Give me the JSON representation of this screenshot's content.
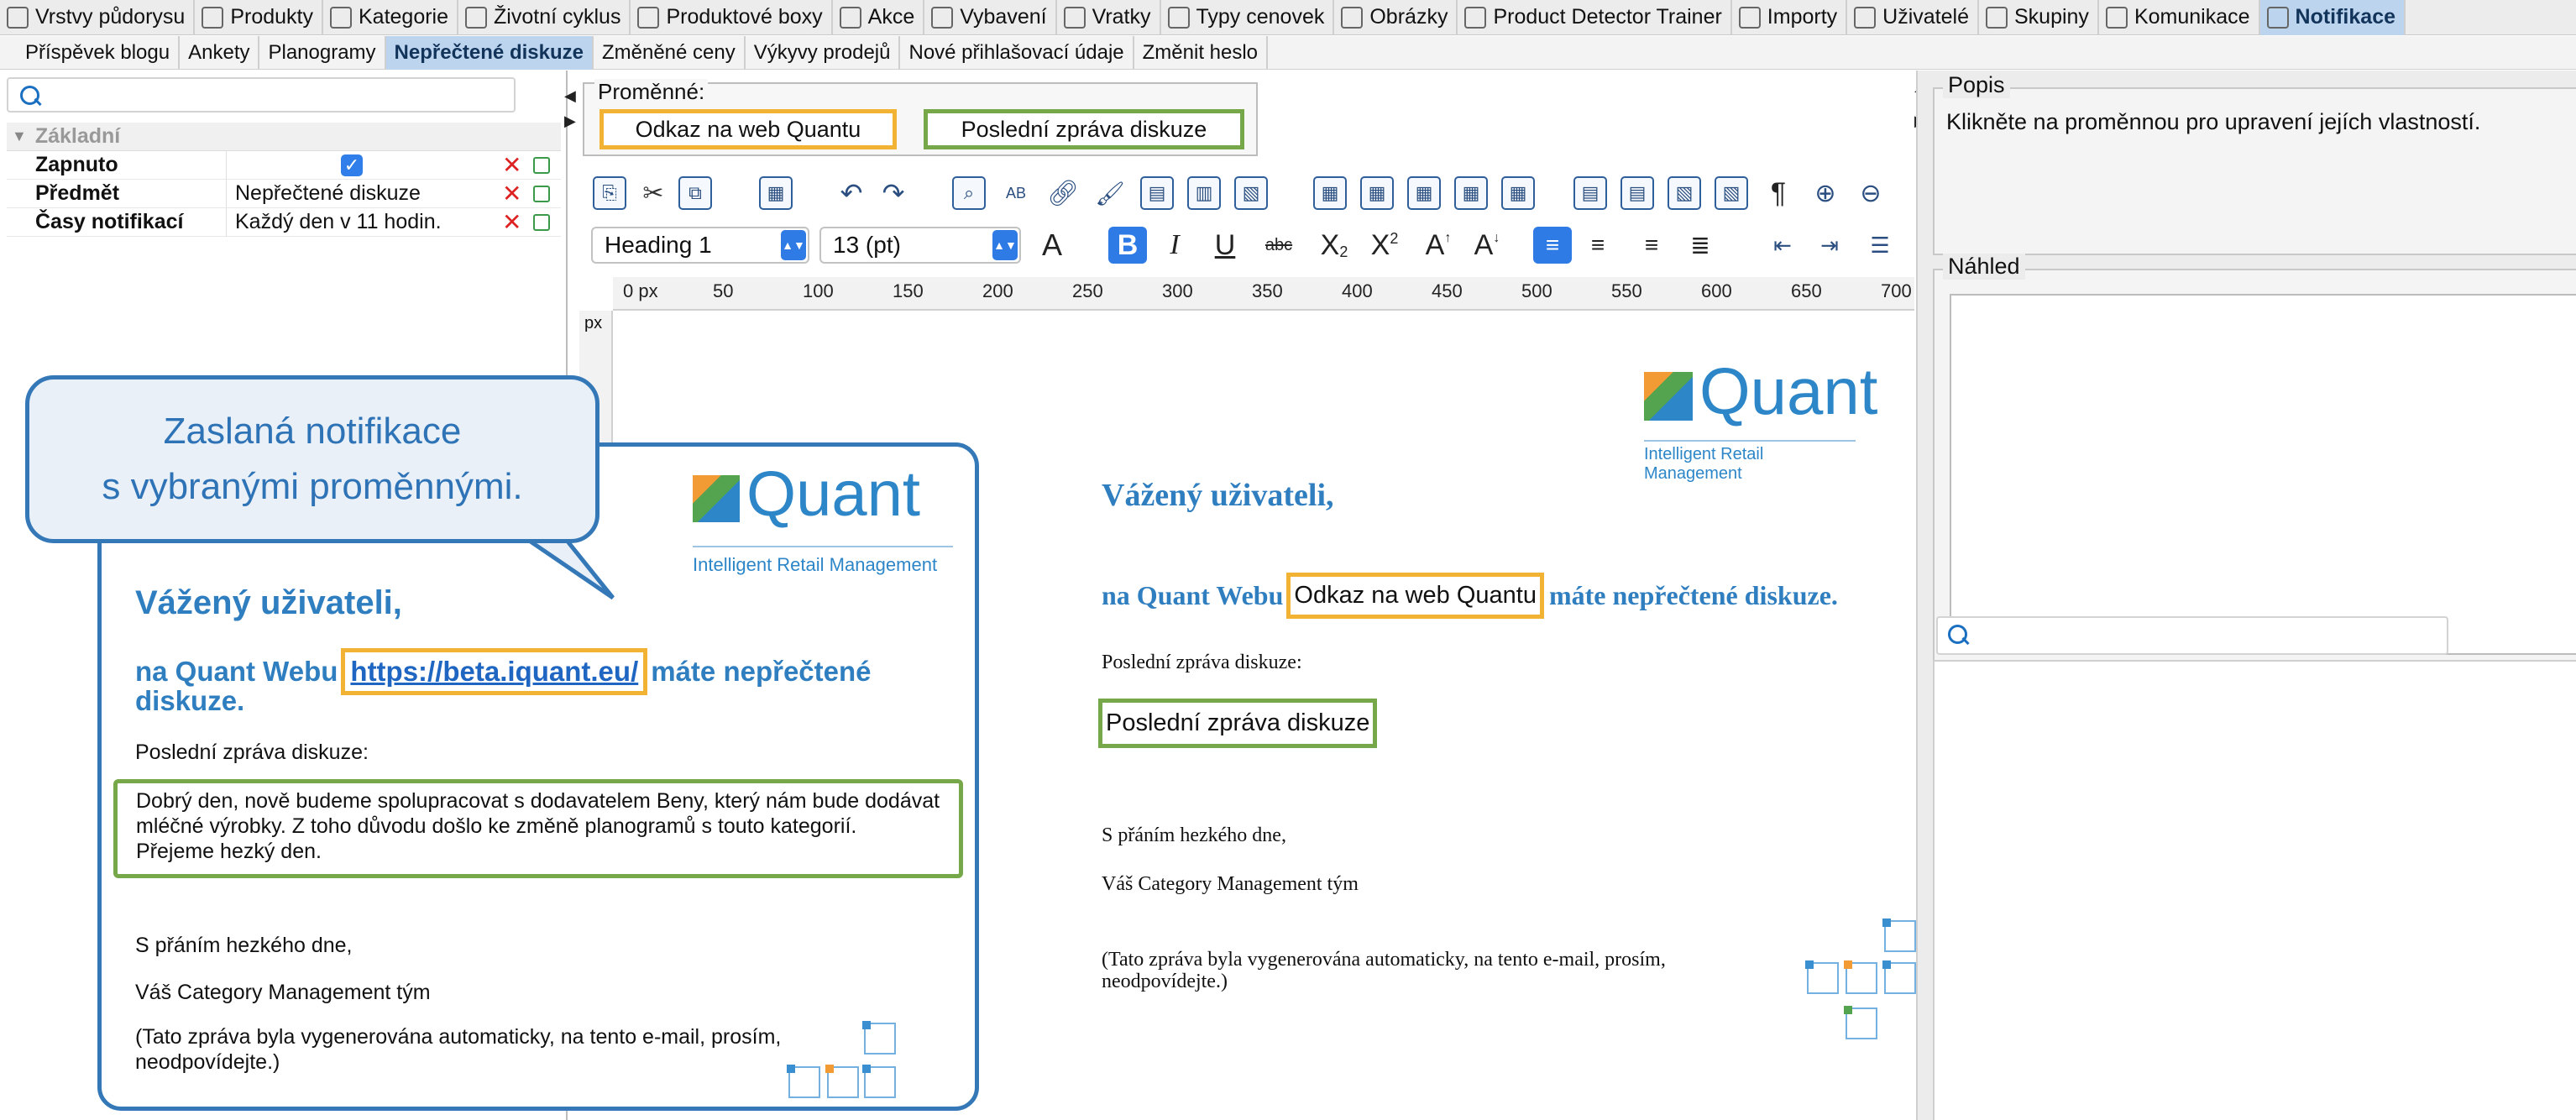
{
  "top_tabs": [
    {
      "label": "Vrstvy půdorysu",
      "icon": "layers-icon"
    },
    {
      "label": "Produkty",
      "icon": "box-icon"
    },
    {
      "label": "Kategorie",
      "icon": "list-icon"
    },
    {
      "label": "Životní cyklus",
      "icon": "lifecycle-icon"
    },
    {
      "label": "Produktové boxy",
      "icon": "product-box-icon"
    },
    {
      "label": "Akce",
      "icon": "action-icon"
    },
    {
      "label": "Vybavení",
      "icon": "equipment-icon"
    },
    {
      "label": "Vratky",
      "icon": "returns-icon"
    },
    {
      "label": "Typy cenovek",
      "icon": "price-tag-icon"
    },
    {
      "label": "Obrázky",
      "icon": "image-icon"
    },
    {
      "label": "Product Detector Trainer",
      "icon": "detector-icon"
    },
    {
      "label": "Importy",
      "icon": "import-icon"
    },
    {
      "label": "Uživatelé",
      "icon": "user-icon"
    },
    {
      "label": "Skupiny",
      "icon": "group-icon"
    },
    {
      "label": "Komunikace",
      "icon": "mail-icon"
    },
    {
      "label": "Notifikace",
      "icon": "notification-icon"
    }
  ],
  "sub_tabs": [
    "Příspěvek blogu",
    "Ankety",
    "Planogramy",
    "Nepřečtené diskuze",
    "Změněné ceny",
    "Výkyvy prodejů",
    "Nové přihlašovací údaje",
    "Změnit heslo"
  ],
  "properties": {
    "group": "Základní",
    "rows": [
      {
        "key": "Zapnuto",
        "value": ""
      },
      {
        "key": "Předmět",
        "value": "Nepřečtené diskuze"
      },
      {
        "key": "Časy notifikací",
        "value": "Každý den v 11 hodin."
      }
    ]
  },
  "variables": {
    "title": "Proměnné:",
    "link_label": "Odkaz na web Quantu",
    "last_message_label": "Poslední zpráva diskuze"
  },
  "format": {
    "style": "Heading 1",
    "size": "13 (pt)"
  },
  "ruler": {
    "unit": "px",
    "labels": [
      "0 px",
      "50",
      "100",
      "150",
      "200",
      "250",
      "300",
      "350",
      "400",
      "450",
      "500",
      "550",
      "600",
      "650",
      "700"
    ]
  },
  "editor": {
    "logo": "Quant",
    "logo_sub": "Intelligent Retail Management",
    "greeting": "Vážený uživateli,",
    "line_before": "na Quant Webu",
    "line_after": "máte nepřečtené diskuze.",
    "last_msg_label": "Poslední zpráva diskuze:",
    "regards": "S přáním hezkého dne,",
    "team": "Váš Category Management tým",
    "footer": "(Tato zpráva byla vygenerována automaticky, na tento e-mail, prosím, neodpovídejte.)"
  },
  "right": {
    "popis_title": "Popis",
    "popis_text": "Klikněte na proměnnou pro upravení jejích vlastností.",
    "nahled_title": "Náhled"
  },
  "callout": {
    "line1": "Zaslaná notifikace",
    "line2": "s vybranými proměnnými."
  },
  "mail": {
    "logo": "Quant",
    "logo_sub": "Intelligent Retail Management",
    "greeting": "Vážený uživateli,",
    "line_before": "na Quant Webu",
    "link": "https://beta.iquant.eu/",
    "line_after": "máte nepřečtené",
    "line_after2": "diskuze.",
    "last_msg_label": "Poslední zpráva diskuze:",
    "message": "Dobrý den, nově budeme spolupracovat s dodavatelem Beny, který nám bude dodávat mléčné výrobky. Z toho důvodu došlo ke změně planogramů s touto kategorií. Přejeme hezký den.",
    "regards": "S přáním hezkého dne,",
    "team": "Váš Category Management tým",
    "footer": "(Tato zpráva byla vygenerována automaticky, na tento e-mail, prosím, neodpovídejte.)"
  },
  "colors": {
    "accent": "#3478b8",
    "link_var": "#f2b233",
    "msg_var": "#76a84a",
    "active_tab": "#bcd4ee"
  }
}
